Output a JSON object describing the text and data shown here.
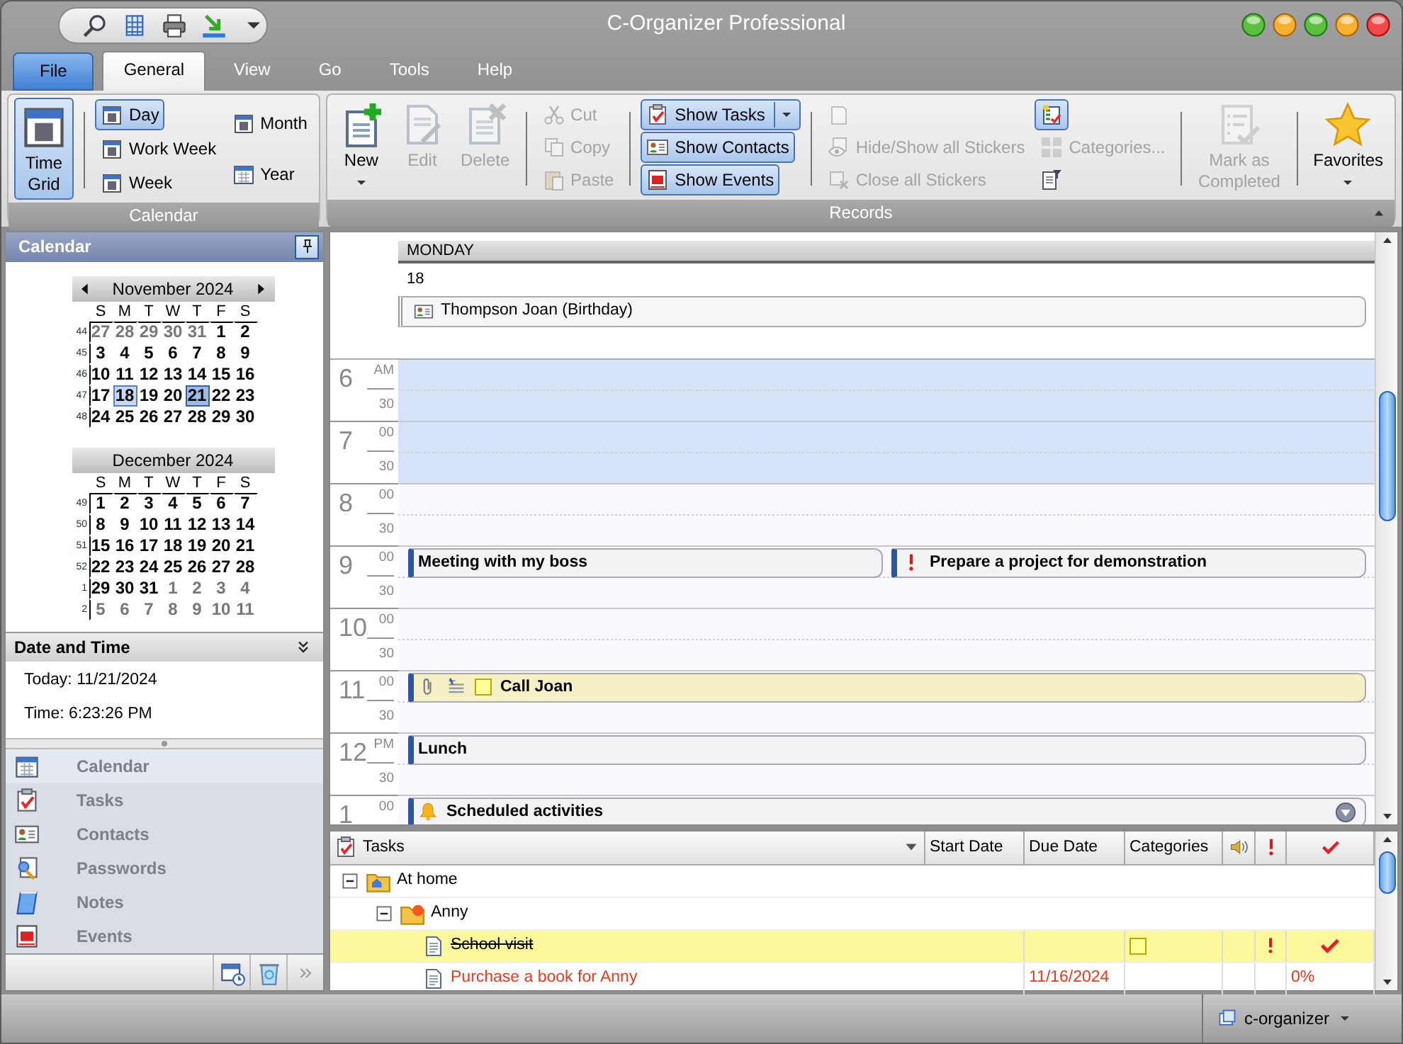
{
  "window": {
    "title": "C-Organizer Professional"
  },
  "menu_tabs": [
    {
      "label": "File",
      "kind": "file",
      "selected": false
    },
    {
      "label": "General",
      "kind": "tab",
      "selected": true
    },
    {
      "label": "View",
      "kind": "tab",
      "selected": false
    },
    {
      "label": "Go",
      "kind": "tab",
      "selected": false
    },
    {
      "label": "Tools",
      "kind": "tab",
      "selected": false
    },
    {
      "label": "Help",
      "kind": "tab",
      "selected": false
    }
  ],
  "ribbon": {
    "groups": [
      {
        "label": "Calendar",
        "columns": [
          {
            "kind": "stack",
            "items": [
              {
                "label": "Time Grid",
                "kind": "large",
                "selected": true,
                "disabled": false
              }
            ]
          },
          {
            "kind": "separator"
          },
          {
            "kind": "stack",
            "items": [
              {
                "label": "Day",
                "kind": "small",
                "selected": true,
                "disabled": false
              },
              {
                "label": "Work Week",
                "kind": "small",
                "selected": false,
                "disabled": false
              },
              {
                "label": "Week",
                "kind": "small",
                "selected": false,
                "disabled": false
              }
            ]
          },
          {
            "kind": "stack",
            "items": [
              {
                "label": "Month",
                "kind": "small",
                "selected": false,
                "disabled": false
              },
              {
                "label": "Year",
                "kind": "small",
                "selected": false,
                "disabled": false
              }
            ]
          }
        ]
      },
      {
        "label": "Records",
        "columns": [
          {
            "kind": "stack",
            "items": [
              {
                "label": "New",
                "kind": "large",
                "selected": false,
                "disabled": false,
                "dropdown": true
              }
            ]
          },
          {
            "kind": "stack",
            "items": [
              {
                "label": "Edit",
                "kind": "large",
                "selected": false,
                "disabled": true
              }
            ]
          },
          {
            "kind": "stack",
            "items": [
              {
                "label": "Delete",
                "kind": "large",
                "selected": false,
                "disabled": true
              }
            ]
          },
          {
            "kind": "separator"
          },
          {
            "kind": "stack",
            "items": [
              {
                "label": "Cut",
                "kind": "small",
                "selected": false,
                "disabled": true
              },
              {
                "label": "Copy",
                "kind": "small",
                "selected": false,
                "disabled": true
              },
              {
                "label": "Paste",
                "kind": "small",
                "selected": false,
                "disabled": true
              }
            ]
          },
          {
            "kind": "separator"
          },
          {
            "kind": "stack",
            "items": [
              {
                "label": "Show Tasks",
                "kind": "small",
                "selected": true,
                "disabled": false,
                "split": true
              },
              {
                "label": "Show Contacts",
                "kind": "small",
                "selected": true,
                "disabled": false
              },
              {
                "label": "Show Events",
                "kind": "small",
                "selected": true,
                "disabled": false
              }
            ]
          },
          {
            "kind": "separator"
          },
          {
            "kind": "stack",
            "items": [
              {
                "kind": "icon",
                "selected": false,
                "disabled": true
              },
              {
                "label": "Hide/Show all Stickers",
                "kind": "small",
                "selected": false,
                "disabled": true
              },
              {
                "label": "Close all Stickers",
                "kind": "small",
                "selected": false,
                "disabled": true
              }
            ]
          },
          {
            "kind": "stack",
            "items": [
              {
                "kind": "icon",
                "selected": true,
                "disabled": false
              },
              {
                "label": "Categories...",
                "kind": "small",
                "selected": false,
                "disabled": true
              },
              {
                "kind": "icon",
                "selected": false,
                "disabled": false
              }
            ]
          },
          {
            "kind": "separator"
          },
          {
            "kind": "stack",
            "items": [
              {
                "label": "Mark as Completed",
                "kind": "large",
                "selected": false,
                "disabled": true
              }
            ]
          },
          {
            "kind": "separator"
          },
          {
            "kind": "stack",
            "items": [
              {
                "label": "Favorites",
                "kind": "large",
                "selected": false,
                "disabled": false,
                "dropdown": true
              }
            ]
          }
        ]
      }
    ]
  },
  "navigation": {
    "title": "Calendar",
    "months": [
      {
        "title": "November 2024",
        "arrows": true,
        "weekdays": [
          "S",
          "M",
          "T",
          "W",
          "T",
          "F",
          "S"
        ],
        "weeks": [
          {
            "number": "44",
            "days": [
              {
                "t": "27",
                "muted": true,
                "selected": false,
                "today": false
              },
              {
                "t": "28",
                "muted": true,
                "selected": false,
                "today": false
              },
              {
                "t": "29",
                "muted": true,
                "selected": false,
                "today": false
              },
              {
                "t": "30",
                "muted": true,
                "selected": false,
                "today": false
              },
              {
                "t": "31",
                "muted": true,
                "selected": false,
                "today": false
              },
              {
                "t": "1",
                "muted": false,
                "selected": false,
                "today": false
              },
              {
                "t": "2",
                "muted": false,
                "selected": false,
                "today": false
              }
            ]
          },
          {
            "number": "45",
            "days": [
              {
                "t": "3",
                "muted": false,
                "selected": false,
                "today": false
              },
              {
                "t": "4",
                "muted": false,
                "selected": false,
                "today": false
              },
              {
                "t": "5",
                "muted": false,
                "selected": false,
                "today": false
              },
              {
                "t": "6",
                "muted": false,
                "selected": false,
                "today": false
              },
              {
                "t": "7",
                "muted": false,
                "selected": false,
                "today": false
              },
              {
                "t": "8",
                "muted": false,
                "selected": false,
                "today": false
              },
              {
                "t": "9",
                "muted": false,
                "selected": false,
                "today": false
              }
            ]
          },
          {
            "number": "46",
            "days": [
              {
                "t": "10",
                "muted": false,
                "selected": false,
                "today": false
              },
              {
                "t": "11",
                "muted": false,
                "selected": false,
                "today": false
              },
              {
                "t": "12",
                "muted": false,
                "selected": false,
                "today": false
              },
              {
                "t": "13",
                "muted": false,
                "selected": false,
                "today": false
              },
              {
                "t": "14",
                "muted": false,
                "selected": false,
                "today": false
              },
              {
                "t": "15",
                "muted": false,
                "selected": false,
                "today": false
              },
              {
                "t": "16",
                "muted": false,
                "selected": false,
                "today": false
              }
            ]
          },
          {
            "number": "47",
            "days": [
              {
                "t": "17",
                "muted": false,
                "selected": false,
                "today": false
              },
              {
                "t": "18",
                "muted": false,
                "selected": true,
                "today": false
              },
              {
                "t": "19",
                "muted": false,
                "selected": false,
                "today": false
              },
              {
                "t": "20",
                "muted": false,
                "selected": false,
                "today": false
              },
              {
                "t": "21",
                "muted": false,
                "selected": false,
                "today": true
              },
              {
                "t": "22",
                "muted": false,
                "selected": false,
                "today": false
              },
              {
                "t": "23",
                "muted": false,
                "selected": false,
                "today": false
              }
            ]
          },
          {
            "number": "48",
            "days": [
              {
                "t": "24",
                "muted": false,
                "selected": false,
                "today": false
              },
              {
                "t": "25",
                "muted": false,
                "selected": false,
                "today": false
              },
              {
                "t": "26",
                "muted": false,
                "selected": false,
                "today": false
              },
              {
                "t": "27",
                "muted": false,
                "selected": false,
                "today": false
              },
              {
                "t": "28",
                "muted": false,
                "selected": false,
                "today": false
              },
              {
                "t": "29",
                "muted": false,
                "selected": false,
                "today": false
              },
              {
                "t": "30",
                "muted": false,
                "selected": false,
                "today": false
              }
            ]
          }
        ]
      },
      {
        "title": "December 2024",
        "arrows": false,
        "weekdays": [
          "S",
          "M",
          "T",
          "W",
          "T",
          "F",
          "S"
        ],
        "weeks": [
          {
            "number": "49",
            "days": [
              {
                "t": "1",
                "muted": false,
                "selected": false,
                "today": false
              },
              {
                "t": "2",
                "muted": false,
                "selected": false,
                "today": false
              },
              {
                "t": "3",
                "muted": false,
                "selected": false,
                "today": false
              },
              {
                "t": "4",
                "muted": false,
                "selected": false,
                "today": false
              },
              {
                "t": "5",
                "muted": false,
                "selected": false,
                "today": false
              },
              {
                "t": "6",
                "muted": false,
                "selected": false,
                "today": false
              },
              {
                "t": "7",
                "muted": false,
                "selected": false,
                "today": false
              }
            ]
          },
          {
            "number": "50",
            "days": [
              {
                "t": "8",
                "muted": false,
                "selected": false,
                "today": false
              },
              {
                "t": "9",
                "muted": false,
                "selected": false,
                "today": false
              },
              {
                "t": "10",
                "muted": false,
                "selected": false,
                "today": false
              },
              {
                "t": "11",
                "muted": false,
                "selected": false,
                "today": false
              },
              {
                "t": "12",
                "muted": false,
                "selected": false,
                "today": false
              },
              {
                "t": "13",
                "muted": false,
                "selected": false,
                "today": false
              },
              {
                "t": "14",
                "muted": false,
                "selected": false,
                "today": false
              }
            ]
          },
          {
            "number": "51",
            "days": [
              {
                "t": "15",
                "muted": false,
                "selected": false,
                "today": false
              },
              {
                "t": "16",
                "muted": false,
                "selected": false,
                "today": false
              },
              {
                "t": "17",
                "muted": false,
                "selected": false,
                "today": false
              },
              {
                "t": "18",
                "muted": false,
                "selected": false,
                "today": false
              },
              {
                "t": "19",
                "muted": false,
                "selected": false,
                "today": false
              },
              {
                "t": "20",
                "muted": false,
                "selected": false,
                "today": false
              },
              {
                "t": "21",
                "muted": false,
                "selected": false,
                "today": false
              }
            ]
          },
          {
            "number": "52",
            "days": [
              {
                "t": "22",
                "muted": false,
                "selected": false,
                "today": false
              },
              {
                "t": "23",
                "muted": false,
                "selected": false,
                "today": false
              },
              {
                "t": "24",
                "muted": false,
                "selected": false,
                "today": false
              },
              {
                "t": "25",
                "muted": false,
                "selected": false,
                "today": false
              },
              {
                "t": "26",
                "muted": false,
                "selected": false,
                "today": false
              },
              {
                "t": "27",
                "muted": false,
                "selected": false,
                "today": false
              },
              {
                "t": "28",
                "muted": false,
                "selected": false,
                "today": false
              }
            ]
          },
          {
            "number": "1",
            "days": [
              {
                "t": "29",
                "muted": false,
                "selected": false,
                "today": false
              },
              {
                "t": "30",
                "muted": false,
                "selected": false,
                "today": false
              },
              {
                "t": "31",
                "muted": false,
                "selected": false,
                "today": false
              },
              {
                "t": "1",
                "muted": true,
                "selected": false,
                "today": false
              },
              {
                "t": "2",
                "muted": true,
                "selected": false,
                "today": false
              },
              {
                "t": "3",
                "muted": true,
                "selected": false,
                "today": false
              },
              {
                "t": "4",
                "muted": true,
                "selected": false,
                "today": false
              }
            ]
          },
          {
            "number": "2",
            "days": [
              {
                "t": "5",
                "muted": true,
                "selected": false,
                "today": false
              },
              {
                "t": "6",
                "muted": true,
                "selected": false,
                "today": false
              },
              {
                "t": "7",
                "muted": true,
                "selected": false,
                "today": false
              },
              {
                "t": "8",
                "muted": true,
                "selected": false,
                "today": false
              },
              {
                "t": "9",
                "muted": true,
                "selected": false,
                "today": false
              },
              {
                "t": "10",
                "muted": true,
                "selected": false,
                "today": false
              },
              {
                "t": "11",
                "muted": true,
                "selected": false,
                "today": false
              }
            ]
          }
        ]
      }
    ],
    "date_time": {
      "title": "Date and Time",
      "lines": [
        "Today: 11/21/2024",
        "Time: 6:23:26 PM"
      ]
    },
    "sections": [
      {
        "label": "Calendar",
        "selected": true
      },
      {
        "label": "Tasks",
        "selected": false
      },
      {
        "label": "Contacts",
        "selected": false
      },
      {
        "label": "Passwords",
        "selected": false
      },
      {
        "label": "Notes",
        "selected": false
      },
      {
        "label": "Events",
        "selected": false
      }
    ]
  },
  "day_view": {
    "weekday": "MONDAY",
    "date": "18",
    "all_day": [
      {
        "title": "Thompson Joan (Birthday)",
        "contact": true
      }
    ],
    "slots": [
      {
        "hour": "6",
        "minute": "AM",
        "half": "30",
        "working_hours": false
      },
      {
        "hour": "7",
        "minute": "00",
        "half": "30",
        "working_hours": false
      },
      {
        "hour": "8",
        "minute": "00",
        "half": "30",
        "working_hours": true
      },
      {
        "hour": "9",
        "minute": "00",
        "half": "30",
        "working_hours": true,
        "events": [
          {
            "title": "Meeting with my boss",
            "color": "#f3f3f6"
          },
          {
            "title": "Prepare a project for demonstration",
            "color": "#f3f3f6",
            "important": true
          }
        ]
      },
      {
        "hour": "10",
        "minute": "00",
        "half": "30",
        "working_hours": true
      },
      {
        "hour": "11",
        "minute": "00",
        "half": "30",
        "working_hours": true,
        "events": [
          {
            "title": "Call Joan",
            "color": "#f5f1c4",
            "attachment": true,
            "note": true,
            "categorized": true
          }
        ]
      },
      {
        "hour": "12",
        "minute": "PM",
        "half": "30",
        "working_hours": true,
        "events": [
          {
            "title": "Lunch",
            "color": "#f3f3f6"
          }
        ]
      },
      {
        "hour": "1",
        "minute": "00",
        "working_hours": true,
        "events": [
          {
            "title": "Scheduled activities",
            "color": "#f3f3f6",
            "reminder": true,
            "more": true
          }
        ]
      }
    ]
  },
  "tasks": {
    "columns": [
      {
        "label": "Tasks",
        "kind": "text"
      },
      {
        "label": "Start Date",
        "kind": "text"
      },
      {
        "label": "Due Date",
        "kind": "text"
      },
      {
        "label": "Categories",
        "kind": "text"
      },
      {
        "kind": "reminder"
      },
      {
        "kind": "priority"
      },
      {
        "kind": "complete"
      }
    ],
    "rows": [
      {
        "title": "At home",
        "kind": "folder",
        "expanded": true,
        "children": [
          {
            "title": "Anny",
            "kind": "folder",
            "expanded": true,
            "children": [
              {
                "title": "School visit",
                "kind": "task",
                "selected": true,
                "completed": true,
                "overdue": false,
                "important": true,
                "categorized": true
              },
              {
                "title": "Purchase a book for Anny",
                "kind": "task",
                "selected": false,
                "completed": false,
                "overdue": true,
                "important": false,
                "categorized": false,
                "due_date": "11/16/2024",
                "progress": "0%"
              }
            ]
          }
        ]
      }
    ]
  },
  "status_bar": {
    "database": "c-organizer"
  }
}
